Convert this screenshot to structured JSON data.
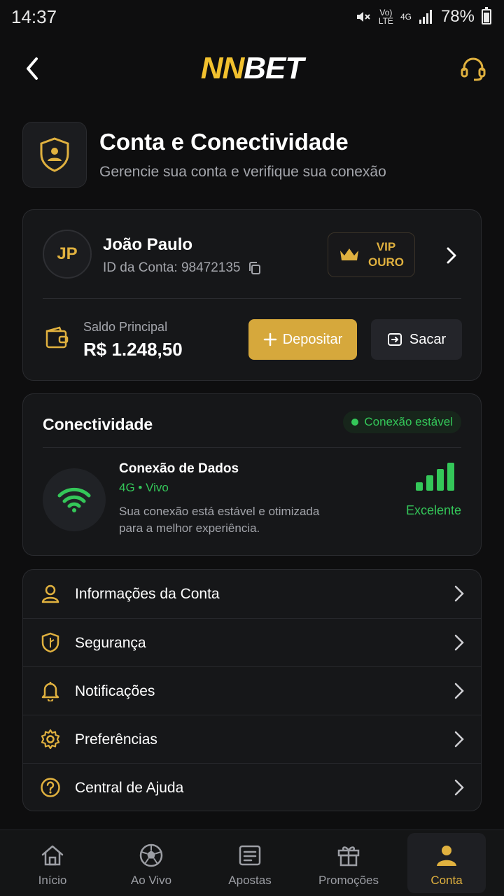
{
  "status_bar": {
    "time": "14:37",
    "network_top": "Vo)",
    "network_bottom": "LTE",
    "net_type": "4G",
    "battery": "78%"
  },
  "header": {
    "logo_part1": "NN",
    "logo_part2": "BET"
  },
  "page": {
    "title": "Conta e Conectividade",
    "subtitle": "Gerencie sua conta e verifique sua conexão"
  },
  "account": {
    "initials": "JP",
    "name": "João Paulo",
    "id_label": "ID da Conta: 98472135",
    "vip_line1": "VIP",
    "vip_line2": "OURO",
    "balance_label": "Saldo Principal",
    "balance_value": "R$ 1.248,50",
    "deposit_label": "Depositar",
    "withdraw_label": "Sacar"
  },
  "connectivity": {
    "title": "Conectividade",
    "status": "Conexão estável",
    "data_title": "Conexão de Dados",
    "data_type": "4G • Vivo",
    "description": "Sua conexão está estável e otimizada para a melhor experiência.",
    "quality": "Excelente",
    "signal_level": 1.0
  },
  "menu": {
    "items": [
      {
        "label": "Informações da Conta",
        "icon": "user-icon"
      },
      {
        "label": "Segurança",
        "icon": "shield-icon"
      },
      {
        "label": "Notificações",
        "icon": "bell-icon"
      },
      {
        "label": "Preferências",
        "icon": "gear-icon"
      },
      {
        "label": "Central de Ajuda",
        "icon": "help-icon"
      }
    ]
  },
  "bottom_nav": {
    "items": [
      {
        "label": "Início",
        "icon": "home-icon"
      },
      {
        "label": "Ao Vivo",
        "icon": "soccer-ball-icon"
      },
      {
        "label": "Apostas",
        "icon": "ticket-icon"
      },
      {
        "label": "Promoções",
        "icon": "gift-icon"
      },
      {
        "label": "Conta",
        "icon": "user-icon"
      }
    ],
    "active": "Conta"
  },
  "colors": {
    "accent": "#e0b13f",
    "success": "#34c759",
    "background": "#0e0e0f"
  }
}
